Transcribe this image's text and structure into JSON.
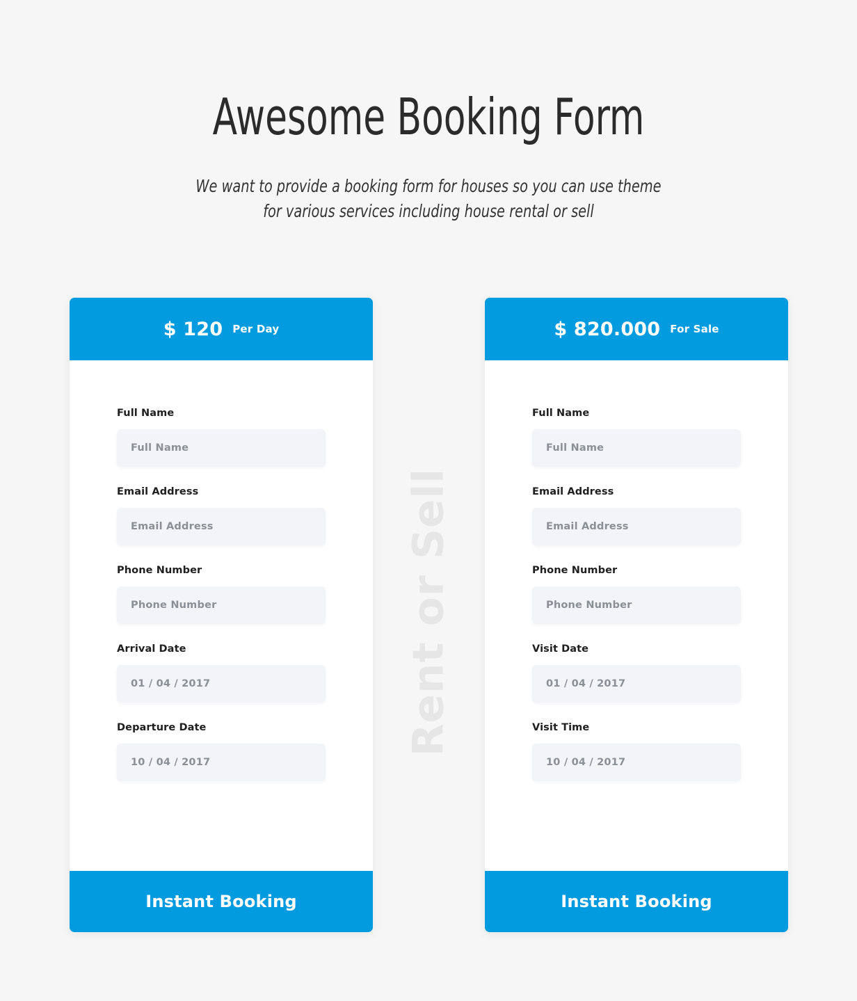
{
  "header": {
    "title": "Awesome Booking Form",
    "subtitle_line1": "We want to provide a booking form for houses so you can use theme",
    "subtitle_line2": "for various services including house rental or sell"
  },
  "watermark": {
    "text": "Rent or Sell",
    "color": "#e6e6e6"
  },
  "theme": {
    "accent": "#039be0",
    "page_background": "#f6f6f6",
    "card_background": "#ffffff",
    "input_background": "#f2f4f7",
    "label_color": "#1f1f1f",
    "placeholder_color": "#8b8f96"
  },
  "cards": [
    {
      "id": "rent-card",
      "price": "$ 120",
      "price_note": "Per Day",
      "submit_label": "Instant Booking",
      "fields": [
        {
          "name": "full-name",
          "label": "Full Name",
          "placeholder": "Full Name",
          "value": ""
        },
        {
          "name": "email-address",
          "label": "Email Address",
          "placeholder": "Email Address",
          "value": ""
        },
        {
          "name": "phone-number",
          "label": "Phone Number",
          "placeholder": "Phone Number",
          "value": ""
        },
        {
          "name": "arrival-date",
          "label": "Arrival Date",
          "placeholder": "01 / 04 / 2017",
          "value": ""
        },
        {
          "name": "departure-date",
          "label": "Departure Date",
          "placeholder": "10 / 04 / 2017",
          "value": ""
        }
      ]
    },
    {
      "id": "sale-card",
      "price": "$ 820.000",
      "price_note": "For Sale",
      "submit_label": "Instant Booking",
      "fields": [
        {
          "name": "full-name",
          "label": "Full Name",
          "placeholder": "Full Name",
          "value": ""
        },
        {
          "name": "email-address",
          "label": "Email Address",
          "placeholder": "Email Address",
          "value": ""
        },
        {
          "name": "phone-number",
          "label": "Phone Number",
          "placeholder": "Phone Number",
          "value": ""
        },
        {
          "name": "visit-date",
          "label": "Visit Date",
          "placeholder": "01 / 04 / 2017",
          "value": ""
        },
        {
          "name": "visit-time",
          "label": "Visit Time",
          "placeholder": "10 / 04 / 2017",
          "value": ""
        }
      ]
    }
  ]
}
